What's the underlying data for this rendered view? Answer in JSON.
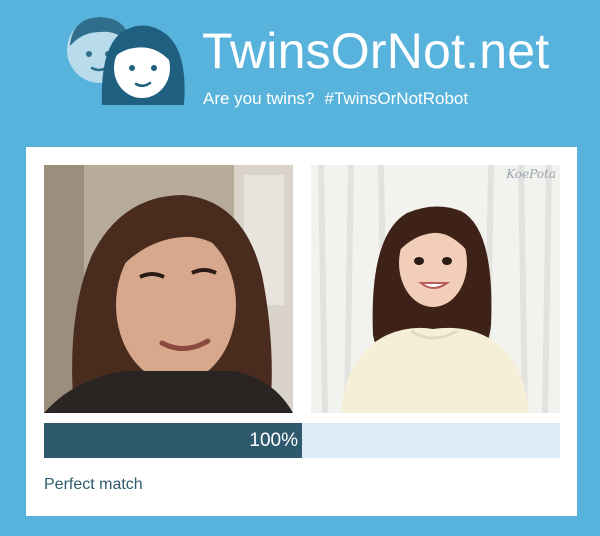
{
  "header": {
    "title": "TwinsOrNot.net",
    "tagline": "Are you twins?",
    "hashtag": "#TwinsOrNotRobot",
    "logo_icon": "twin-faces-icon"
  },
  "comparison": {
    "left_photo": "face-photo-left",
    "right_photo": "face-photo-right",
    "right_watermark": "KoePota",
    "match_percent": "100%",
    "match_fraction": 0.5,
    "result_text": "Perfect match"
  },
  "colors": {
    "background": "#57b3dc",
    "bar_fill": "#2f5a6e",
    "bar_track": "#dcedf7",
    "result_text": "#2f5a6e"
  }
}
